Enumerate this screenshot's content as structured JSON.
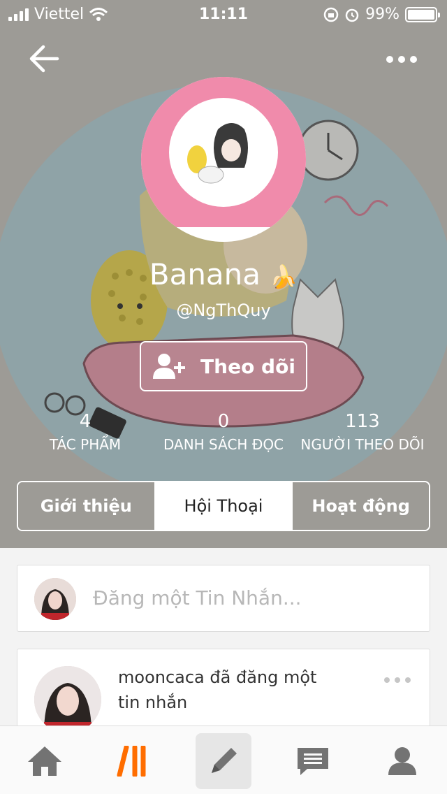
{
  "status_bar": {
    "carrier": "Viettel",
    "time": "11:11",
    "battery": "99%",
    "battery_level": 0.99
  },
  "profile": {
    "name": "Banana",
    "name_emoji": "🍌",
    "handle": "@NgThQuy",
    "follow_label": "Theo dõi"
  },
  "stats": [
    {
      "value": "4",
      "label": "TÁC PHẨM"
    },
    {
      "value": "0",
      "label": "DANH SÁCH ĐỌC"
    },
    {
      "value": "113",
      "label": "NGƯỜI THEO DÕI"
    }
  ],
  "tabs": [
    {
      "label": "Giới thiệu",
      "active": false
    },
    {
      "label": "Hội Thoại",
      "active": true
    },
    {
      "label": "Hoạt động",
      "active": false
    }
  ],
  "compose": {
    "placeholder": "Đăng một Tin Nhắn..."
  },
  "messages": [
    {
      "text_line1": "mooncaca đã đăng một",
      "text_line2": "tin nhắn"
    }
  ],
  "tabbar": {
    "items": [
      {
        "icon": "home-icon"
      },
      {
        "icon": "wattpad-logo-icon"
      },
      {
        "icon": "pencil-icon",
        "active": true
      },
      {
        "icon": "chat-icon"
      },
      {
        "icon": "profile-icon"
      }
    ]
  },
  "colors": {
    "header_overlay": "#9d9b96",
    "avatar_pink": "#f08bab",
    "brand_orange": "#ff6d00",
    "icon_gray": "#737373"
  }
}
